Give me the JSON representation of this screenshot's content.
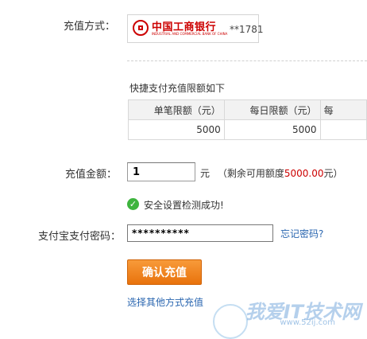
{
  "payment_method": {
    "label": "充值方式：",
    "bank_name": "中国工商银行",
    "bank_name_en": "INDUSTRIAL AND COMMERCIAL BANK OF CHINA",
    "card_suffix": "**1781"
  },
  "limits": {
    "caption": "快捷支付充值限额如下",
    "headers": [
      "单笔限额（元）",
      "每日限额（元）",
      "每"
    ],
    "values": [
      "5000",
      "5000",
      ""
    ]
  },
  "amount": {
    "label": "充值金额：",
    "value": "1",
    "unit": "元",
    "remaining_prefix": "（剩余可用额度",
    "remaining_value": "5000.00",
    "remaining_suffix": "元）"
  },
  "security": {
    "message": "安全设置检测成功!"
  },
  "password": {
    "label": "支付宝支付密码：",
    "value": "**********",
    "forgot_link": "忘记密码?"
  },
  "actions": {
    "confirm_label": "确认充值",
    "other_methods_link": "选择其他方式充值"
  },
  "watermark": {
    "text": "我爱IT技术网",
    "url": "www.52ij.com"
  },
  "colors": {
    "bank_red": "#cc0000",
    "link_blue": "#2a66b0",
    "button_orange": "#f08a1c",
    "success_green": "#3eb43e"
  }
}
